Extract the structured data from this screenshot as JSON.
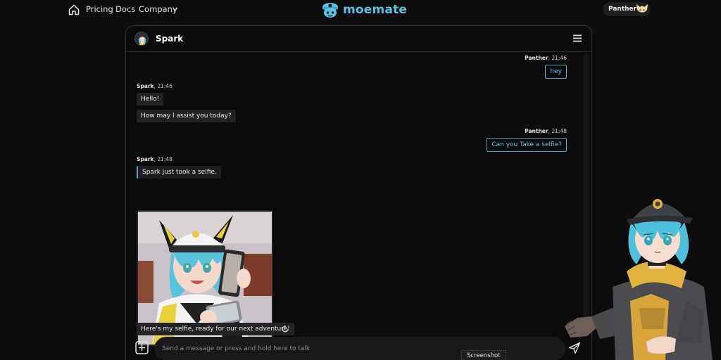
{
  "nav": {
    "pricing": "Pricing",
    "docs": "Docs",
    "company": "Company",
    "logo_text": "moemate",
    "user_name": "Panther"
  },
  "chat": {
    "bot_name": "Spark",
    "messages": [
      {
        "sender": "Panther",
        "time": "21:46",
        "text": "hey"
      },
      {
        "sender": "Spark",
        "time": "21:46",
        "texts": [
          "Hello!",
          "How may I assist you today?"
        ]
      },
      {
        "sender": "Panther",
        "time": "21:48",
        "text": "Can you Take a selfie?"
      },
      {
        "sender": "Spark",
        "time": "21:48",
        "action": "Spark just took a selfie.",
        "caption": "Here's my selfie, ready for our next adventure!"
      }
    ]
  },
  "composer": {
    "placeholder": "Send a message or press and hold here to talk",
    "screenshot_label": "Screenshot"
  },
  "colors": {
    "accent": "#59c3e4",
    "background": "#0d0d0d",
    "bubble": "#232326"
  },
  "icons": [
    "home-icon",
    "chevron-down-icon",
    "menu-icon",
    "add-icon",
    "send-icon",
    "regenerate-icon"
  ]
}
